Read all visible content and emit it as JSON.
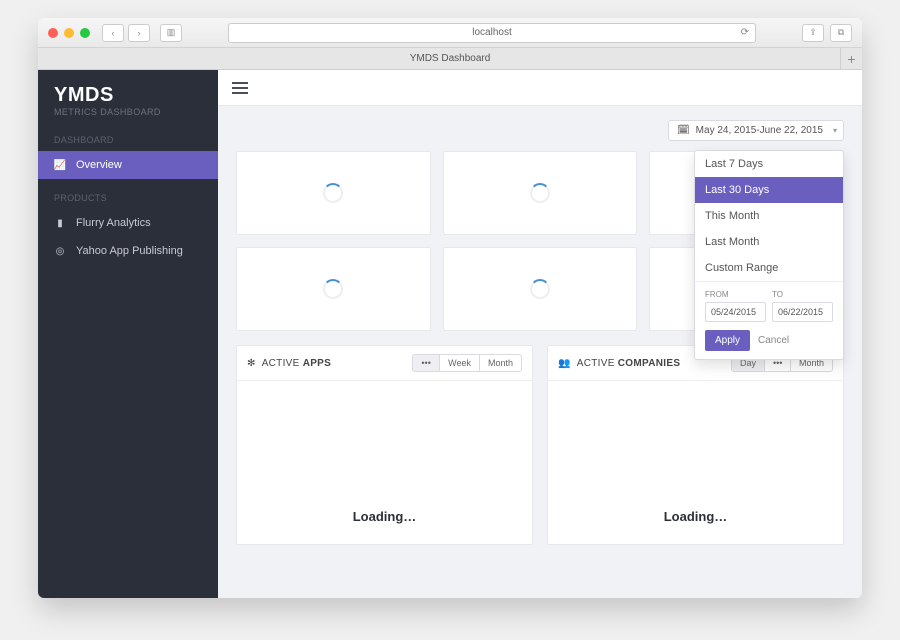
{
  "browser": {
    "url": "localhost",
    "tab_title": "YMDS Dashboard"
  },
  "brand": {
    "title": "YMDS",
    "subtitle": "METRICS DASHBOARD"
  },
  "sidebar": {
    "sections": [
      {
        "header": "DASHBOARD",
        "items": [
          {
            "icon": "chart-area-icon",
            "label": "Overview",
            "active": true
          }
        ]
      },
      {
        "header": "PRODUCTS",
        "items": [
          {
            "icon": "bar-chart-icon",
            "label": "Flurry Analytics",
            "active": false
          },
          {
            "icon": "ad-icon",
            "label": "Yahoo App Publishing",
            "active": false
          }
        ]
      }
    ]
  },
  "date_button": {
    "label": "May 24, 2015-June 22, 2015"
  },
  "date_dropdown": {
    "options": [
      "Last 7 Days",
      "Last 30 Days",
      "This Month",
      "Last Month",
      "Custom Range"
    ],
    "selected_index": 1,
    "from_label": "FROM",
    "to_label": "TO",
    "from_value": "05/24/2015",
    "to_value": "06/22/2015",
    "apply": "Apply",
    "cancel": "Cancel"
  },
  "panels": {
    "apps": {
      "title_pre": "ACTIVE ",
      "title_bold": "APPS",
      "segments": [
        "•••",
        "Week",
        "Month"
      ],
      "active_segment": 0,
      "loading": "Loading…"
    },
    "companies": {
      "title_pre": "ACTIVE ",
      "title_bold": "COMPANIES",
      "segments": [
        "Day",
        "•••",
        "Month"
      ],
      "active_segment": 0,
      "loading": "Loading…"
    }
  }
}
